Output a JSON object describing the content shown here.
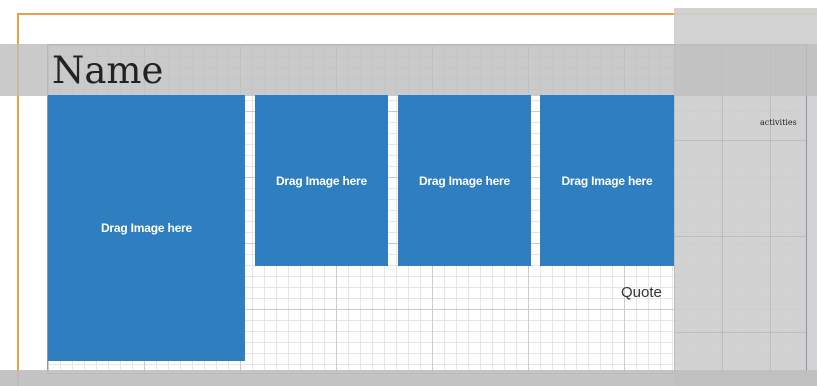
{
  "header": {
    "title": "Name"
  },
  "placeholders": {
    "large": "Drag Image here",
    "small1": "Drag Image here",
    "small2": "Drag Image here",
    "small3": "Drag Image here"
  },
  "labels": {
    "quote": "Quote",
    "side_panel": "activities"
  },
  "colors": {
    "placeholder_fill": "#2f7fc0",
    "page_border": "#e8a33a",
    "overlay_gray": "#bebebe"
  }
}
